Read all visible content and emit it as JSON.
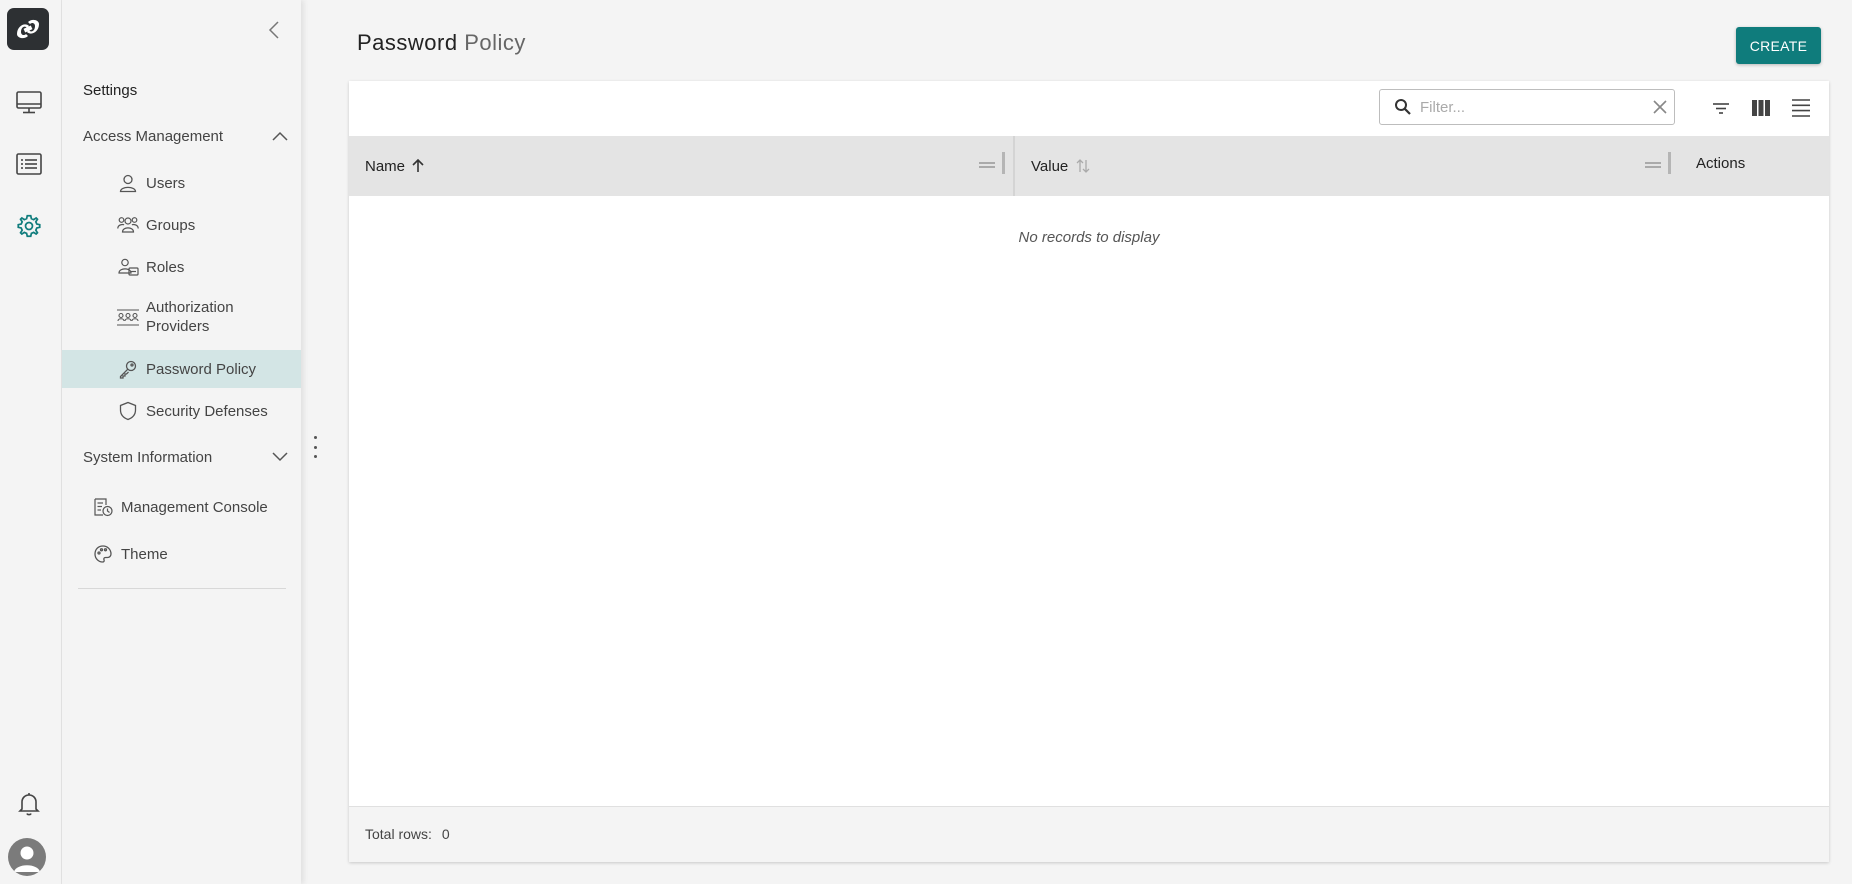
{
  "page": {
    "title_bold": "Password",
    "title_light": "Policy",
    "create_label": "CREATE"
  },
  "rail": {
    "icons": [
      "app-logo-icon",
      "monitor-icon",
      "list-icon",
      "gear-icon",
      "bell-icon",
      "avatar-icon"
    ],
    "accent_color": "#0f7c7c"
  },
  "sidebar": {
    "title": "Settings",
    "groups": [
      {
        "label": "Access Management",
        "expanded": true,
        "items": [
          {
            "label": "Users",
            "icon": "user-icon"
          },
          {
            "label": "Groups",
            "icon": "groups-icon"
          },
          {
            "label": "Roles",
            "icon": "roles-icon"
          },
          {
            "label": "Authorization Providers",
            "icon": "auth-providers-icon"
          },
          {
            "label": "Password Policy",
            "icon": "key-icon",
            "active": true
          },
          {
            "label": "Security Defenses",
            "icon": "shield-icon"
          }
        ]
      },
      {
        "label": "System Information",
        "expanded": false,
        "items": []
      }
    ],
    "extra_items": [
      {
        "label": "Management Console",
        "icon": "console-icon"
      },
      {
        "label": "Theme",
        "icon": "palette-icon"
      }
    ]
  },
  "table": {
    "filter_placeholder": "Filter...",
    "columns": [
      {
        "label": "Name",
        "sort": "ascending"
      },
      {
        "label": "Value",
        "sort": "none"
      },
      {
        "label": "Actions"
      }
    ],
    "empty_message": "No records to display",
    "footer_label": "Total rows:",
    "total_rows": "0"
  },
  "colors": {
    "active_item_bg": "#d3e5e5",
    "button": "#0f7c7c"
  }
}
